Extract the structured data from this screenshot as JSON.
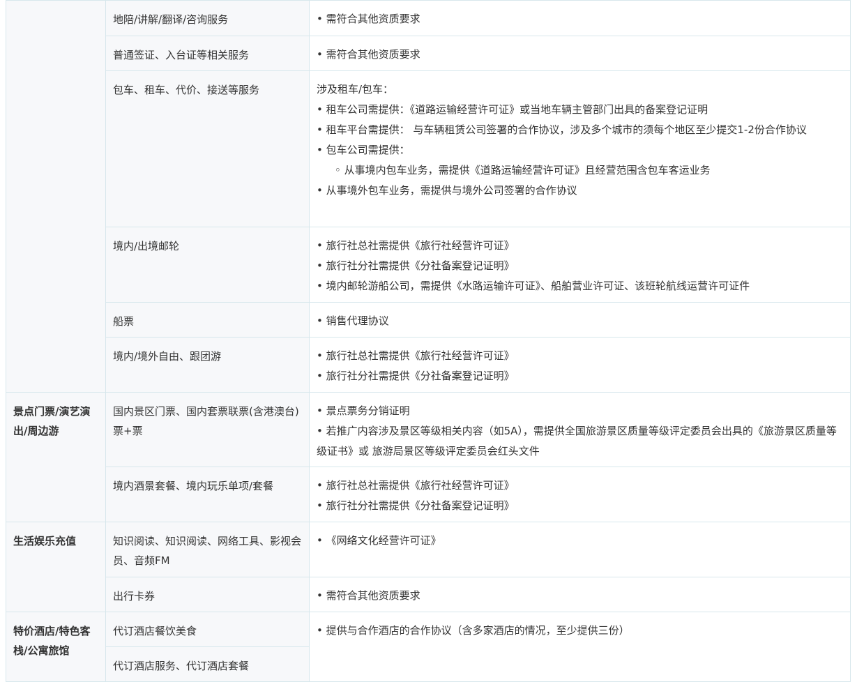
{
  "rows": [
    {
      "category": "",
      "service": "地陪/讲解/翻译/咨询服务",
      "requirements": [
        "• 需符合其他资质要求"
      ]
    },
    {
      "category": "",
      "service": "普通签证、入台证等相关服务",
      "requirements": [
        "• 需符合其他资质要求"
      ]
    },
    {
      "category": "",
      "service": "包车、租车、代价、接送等服务",
      "requirements": [
        "涉及租车/包车：",
        "• 租车公司需提供：《道路运输经营许可证》或当地车辆主管部门出具的备案登记证明",
        "• 租车平台需提供： 与车辆租赁公司签署的合作协议，涉及多个城市的须每个地区至少提交1-2份合作协议",
        "• 包车公司需提供：",
        "◦ 从事境内包车业务，需提供《道路运输经营许可证》且经营范围含包车客运业务",
        "• 从事境外包车业务，需提供与境外公司签署的合作协议"
      ]
    },
    {
      "category": "",
      "service": "境内/出境邮轮",
      "requirements": [
        "• 旅行社总社需提供《旅行社经营许可证》",
        "• 旅行社分社需提供《分社备案登记证明》",
        "• 境内邮轮游船公司，需提供《水路运输许可证》、船舶营业许可证、该班轮航线运营许可证件"
      ]
    },
    {
      "category": "",
      "service": "船票",
      "requirements": [
        "• 销售代理协议"
      ]
    },
    {
      "category": "",
      "service": "境内/境外自由、跟团游",
      "requirements": [
        "• 旅行社总社需提供《旅行社经营许可证》",
        "• 旅行社分社需提供《分社备案登记证明》"
      ]
    },
    {
      "category": "景点门票/演艺演出/周边游",
      "service": "国内景区门票、国内套票联票(含港澳台) 票+票",
      "requirements": [
        "• 景点票务分销证明",
        "• 若推广内容涉及景区等级相关内容（如5A），需提供全国旅游景区质量等级评定委员会出具的《旅游景区质量等级证书》或 旅游局景区等级评定委员会红头文件"
      ]
    },
    {
      "category": "",
      "service": "境内酒景套餐、境内玩乐单项/套餐",
      "requirements": [
        "• 旅行社总社需提供《旅行社经营许可证》",
        "• 旅行社分社需提供《分社备案登记证明》"
      ]
    },
    {
      "category": "生活娱乐充值",
      "service": "知识阅读、知识阅读、网络工具、影视会员、音频FM",
      "requirements": [
        "• 《网络文化经营许可证》"
      ]
    },
    {
      "category": "",
      "service": "出行卡券",
      "requirements": [
        "• 需符合其他资质要求"
      ]
    },
    {
      "category": "特价酒店/特色客栈/公寓旅馆",
      "service": "代订酒店餐饮美食",
      "requirements": [
        "• 提供与合作酒店的合作协议（含多家酒店的情况，至少提供三份）"
      ]
    },
    {
      "category": "",
      "service": "代订酒店服务、代订酒店套餐",
      "requirements": []
    }
  ]
}
